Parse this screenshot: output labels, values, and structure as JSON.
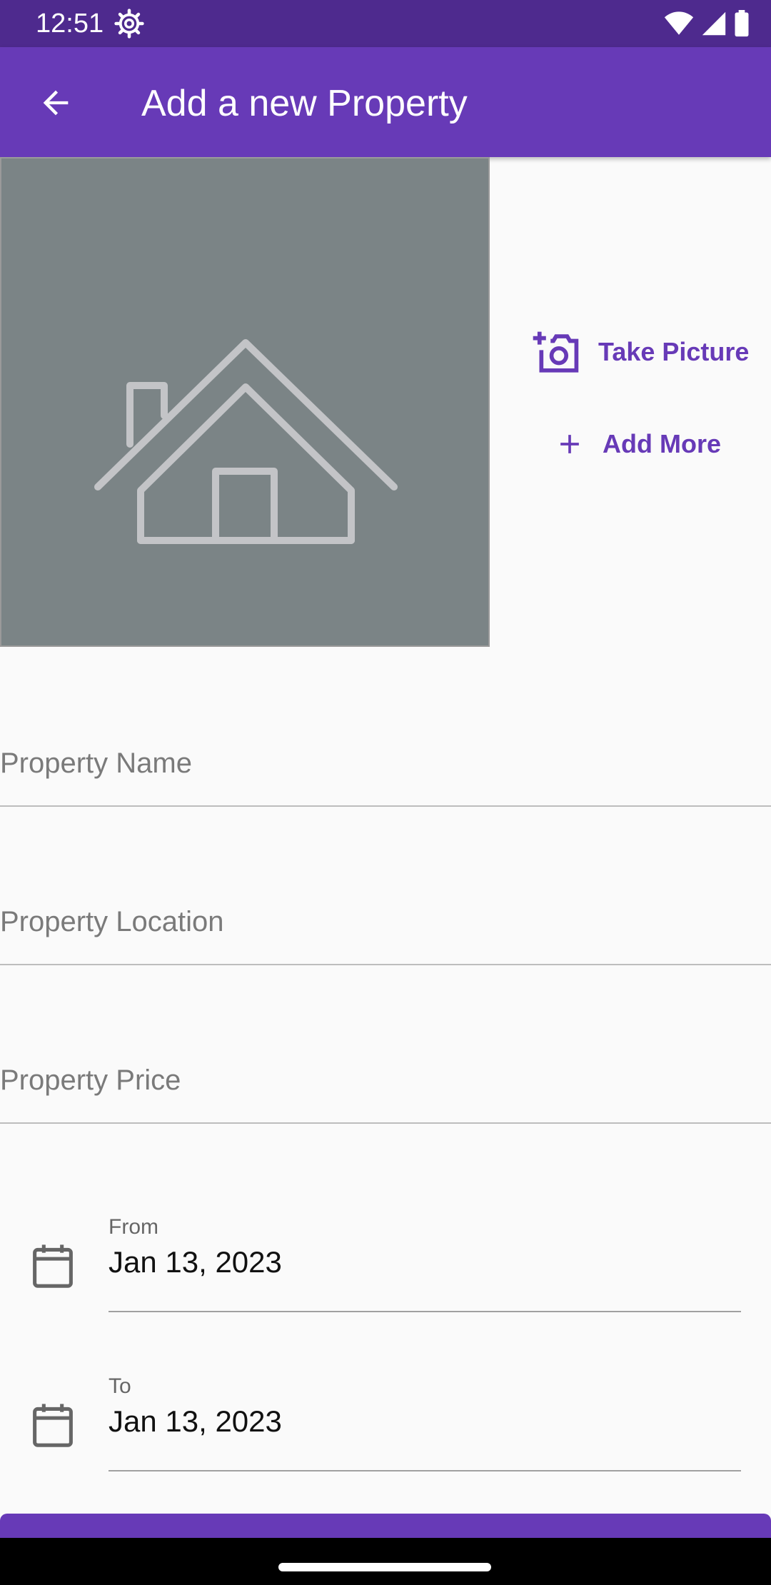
{
  "status_bar": {
    "time": "12:51"
  },
  "app_bar": {
    "title": "Add a new Property"
  },
  "photo_actions": {
    "take_picture": "Take Picture",
    "add_more": "Add More"
  },
  "fields": {
    "name_placeholder": "Property Name",
    "location_placeholder": "Property Location",
    "price_placeholder": "Property Price"
  },
  "dates": {
    "from_label": "From",
    "from_value": "Jan 13, 2023",
    "to_label": "To",
    "to_value": "Jan 13, 2023"
  },
  "colors": {
    "primary": "#673ab7",
    "status_bar": "#4e2a8e",
    "photo_bg": "#7b8486"
  }
}
